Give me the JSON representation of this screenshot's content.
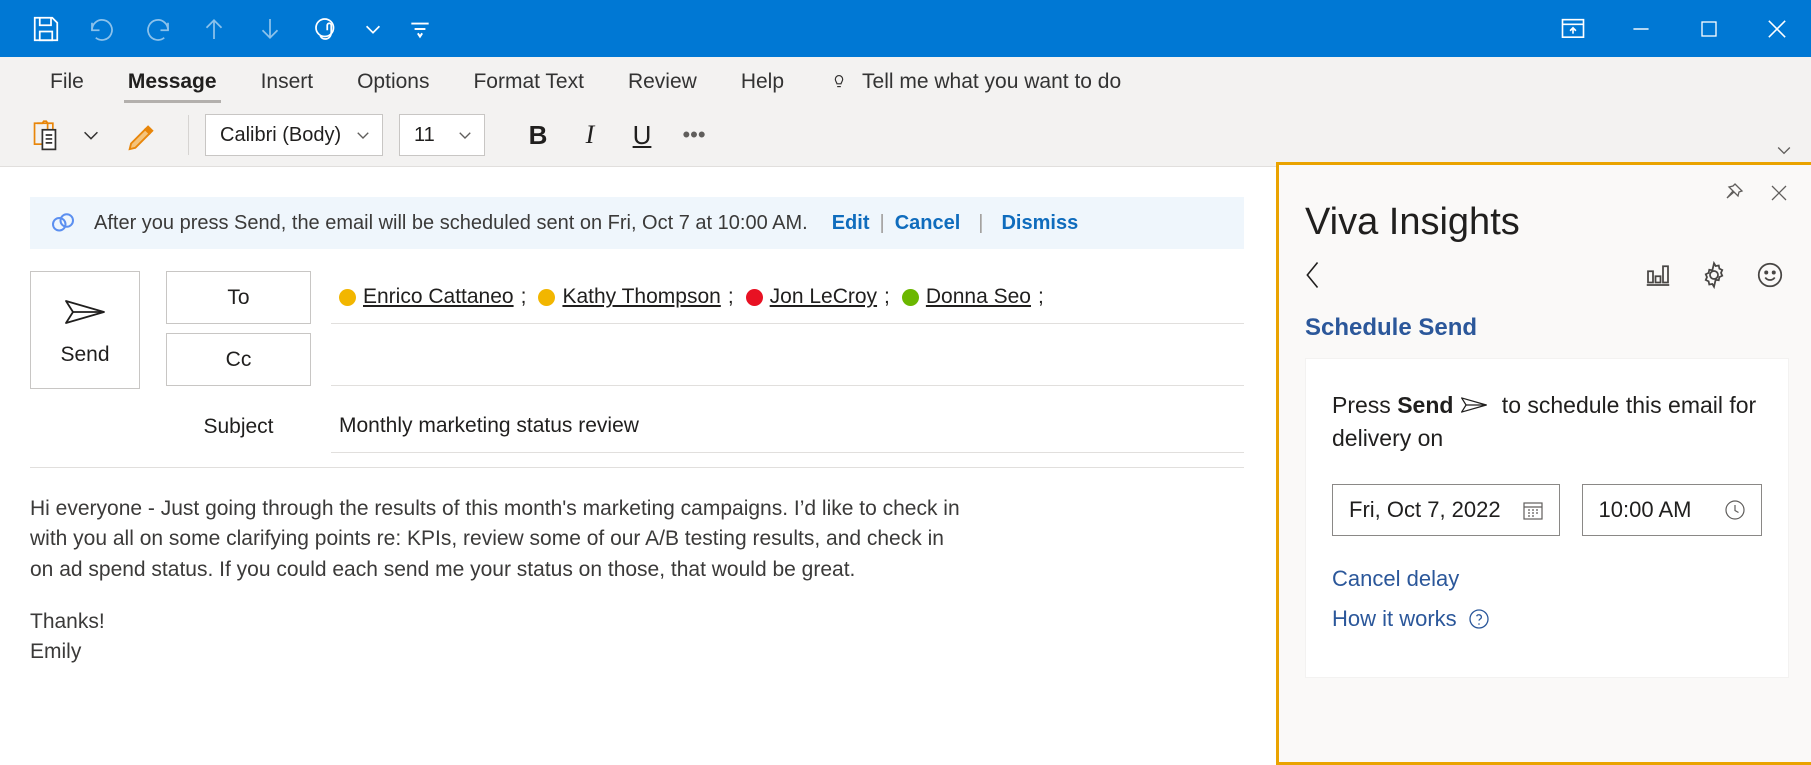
{
  "titlebar": {
    "quick_access": [
      {
        "name": "save-icon",
        "label": "Save"
      },
      {
        "name": "undo-icon",
        "label": "Undo"
      },
      {
        "name": "redo-icon",
        "label": "Redo"
      },
      {
        "name": "move-up-icon",
        "label": "Previous Item"
      },
      {
        "name": "move-down-icon",
        "label": "Next Item"
      },
      {
        "name": "touch-mode-icon",
        "label": "Touch/Mouse Mode"
      },
      {
        "name": "chevron-down-icon",
        "label": "Touch Mode Options"
      },
      {
        "name": "customize-quick-access-icon",
        "label": "Customize Quick Access Toolbar"
      }
    ],
    "window_controls": [
      {
        "name": "ribbon-display-options-icon",
        "label": "Ribbon Display Options"
      },
      {
        "name": "minimize-icon",
        "label": "Minimize"
      },
      {
        "name": "maximize-icon",
        "label": "Maximize"
      },
      {
        "name": "close-icon",
        "label": "Close"
      }
    ]
  },
  "ribbon": {
    "tabs": [
      {
        "label": "File",
        "active": false
      },
      {
        "label": "Message",
        "active": true
      },
      {
        "label": "Insert",
        "active": false
      },
      {
        "label": "Options",
        "active": false
      },
      {
        "label": "Format Text",
        "active": false
      },
      {
        "label": "Review",
        "active": false
      },
      {
        "label": "Help",
        "active": false
      }
    ],
    "tell_me": "Tell me what you want to do",
    "font_name": "Calibri (Body)",
    "font_size": "11",
    "bold": "B",
    "italic": "I",
    "underline": "U",
    "more": "•••"
  },
  "infobar": {
    "message": "After you press Send, the email will be scheduled sent on Fri, Oct 7 at 10:00 AM.",
    "edit": "Edit",
    "cancel": "Cancel",
    "dismiss": "Dismiss",
    "separator": "|"
  },
  "compose": {
    "send_label": "Send",
    "to_label": "To",
    "cc_label": "Cc",
    "subject_label": "Subject",
    "subject_value": "Monthly marketing status review",
    "recipients": [
      {
        "name": "Enrico Cattaneo",
        "presence": "away",
        "sep": ";"
      },
      {
        "name": "Kathy Thompson",
        "presence": "away",
        "sep": ";"
      },
      {
        "name": "Jon LeCroy",
        "presence": "busy",
        "sep": ";"
      },
      {
        "name": "Donna Seo",
        "presence": "avail",
        "sep": ";"
      }
    ],
    "body": {
      "paragraph1": "Hi everyone - Just going through the results of this month's marketing campaigns. I’d like to check in with you all on some clarifying points re: KPIs, review some of our A/B testing results, and check in on ad spend status. If you could each send me your status on those, that would be great.",
      "signoff": "Thanks!",
      "signature": "Emily"
    }
  },
  "panel": {
    "title": "Viva Insights",
    "pin_label": "Pin",
    "close_label": "Close",
    "back_label": "Back",
    "icons": [
      {
        "name": "insights-chart-icon",
        "label": "Insights"
      },
      {
        "name": "settings-gear-icon",
        "label": "Settings"
      },
      {
        "name": "feedback-smiley-icon",
        "label": "Feedback"
      }
    ],
    "schedule_send_link": "Schedule Send",
    "card": {
      "text_before": "Press ",
      "text_bold": "Send",
      "text_after": " to schedule this email for delivery on",
      "date_value": "Fri, Oct 7, 2022",
      "time_value": "10:00 AM",
      "cancel_delay": "Cancel delay",
      "how_it_works": "How it works"
    },
    "accent_color": "#eaa300"
  }
}
